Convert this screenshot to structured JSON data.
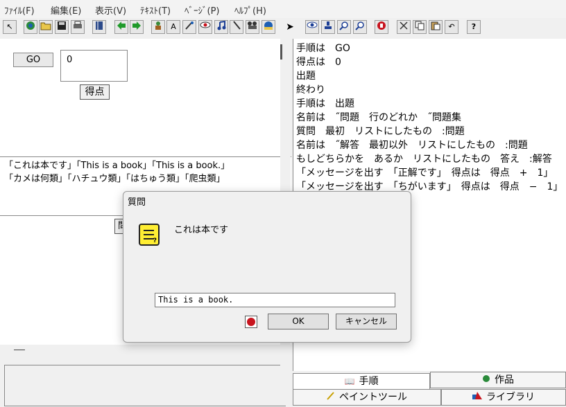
{
  "menu": [
    "ﾌｧｲﾙ(F)",
    "編集(E)",
    "表示(V)",
    "ﾃｷｽﾄ(T)",
    "ﾍﾞｰｼﾞ(P)",
    "ﾍﾙﾌﾟ(H)"
  ],
  "toolbar": {
    "icons": [
      "cursor-tool-icon",
      "world-icon",
      "open-folder-icon",
      "save-icon",
      "print-icon",
      "book-icon",
      "arrow-left-icon",
      "arrow-right-icon",
      "character-icon",
      "text-frame-icon",
      "paint-icon",
      "eye-shape-icon",
      "music-icon",
      "brush-icon",
      "video-icon",
      "globe-user-icon",
      "pointer-icon",
      "eye-icon",
      "stamp-icon",
      "zoom-in-icon",
      "zoom-out-icon",
      "stop-hand-icon",
      "cut-icon",
      "copy-icon",
      "paste-icon",
      "undo-icon",
      "help-icon"
    ],
    "help_label": "?"
  },
  "left": {
    "go_label": "GO",
    "score_value": "0",
    "score_button": "得点",
    "data_lines": [
      "「これは本です」「This is a book」「This is a book.」",
      "「カメは何類」「ハチュウ類」「はちゅう類」「爬虫類」"
    ],
    "partial_button": "問"
  },
  "script_lines": [
    "手順は　GO",
    "得点は　0",
    "出題",
    "終わり",
    "手順は　出題",
    "名前は　˝問題　行のどれか　˝問題集",
    "質問　最初　リストにしたもの　:問題",
    "名前は　˝解答　最初以外　リストにしたもの　:問題",
    "もしどちらかを　あるか　リストにしたもの　答え　:解答",
    "「メッセージを出す　「正解です」　得点は　得点　+　1」",
    "「メッセージを出す　「ちがいます」　得点は　得点　−　1」"
  ],
  "tabs": {
    "procedure": "手順",
    "work": "作品",
    "paint_tool": "ペイントツール",
    "library": "ライブラリ"
  },
  "dialog": {
    "title": "質問",
    "message": "これは本です",
    "input_value": "This is a book.",
    "ok_label": "OK",
    "cancel_label": "キャンセル"
  }
}
